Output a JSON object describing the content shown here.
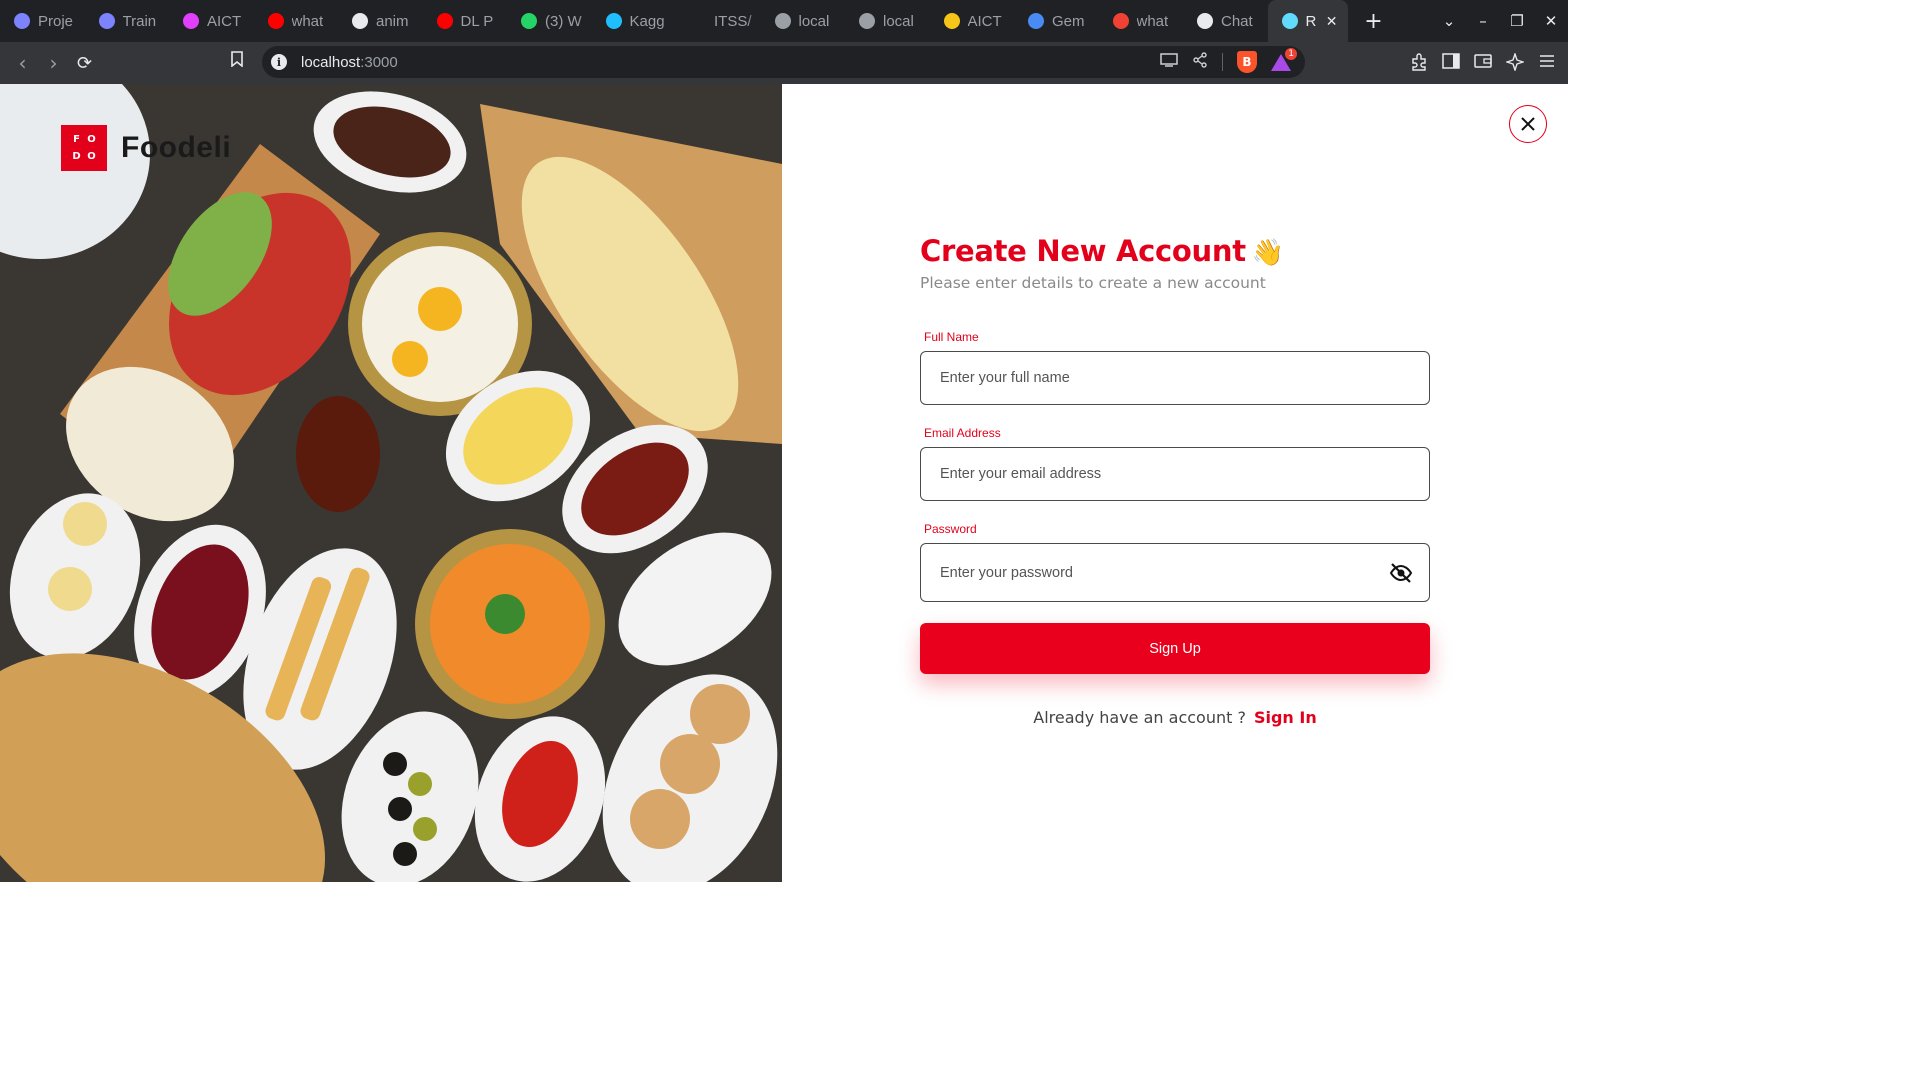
{
  "browser": {
    "tabs": [
      {
        "label": "Proje",
        "icon": "stack-icon",
        "color": "#7c83fd"
      },
      {
        "label": "Train",
        "icon": "stack-icon",
        "color": "#7c83fd"
      },
      {
        "label": "AICT",
        "icon": "play-arrow-icon",
        "color": "#e040fb"
      },
      {
        "label": "what",
        "icon": "youtube-icon",
        "color": "#ff0000"
      },
      {
        "label": "anim",
        "icon": "github-icon",
        "color": "#e8eaed"
      },
      {
        "label": "DL P",
        "icon": "youtube-icon",
        "color": "#ff0000"
      },
      {
        "label": "(3) W",
        "icon": "whatsapp-icon",
        "color": "#25d366"
      },
      {
        "label": "Kagg",
        "icon": "kaggle-icon",
        "color": "#20beff"
      },
      {
        "label": "ITSS/",
        "icon": "github-icon",
        "color": "#202124"
      },
      {
        "label": "local",
        "icon": "globe-icon",
        "color": "#9aa0a6"
      },
      {
        "label": "local",
        "icon": "react-icon",
        "color": "#9aa0a6"
      },
      {
        "label": "AICT",
        "icon": "lightbulb-icon",
        "color": "#f5c518"
      },
      {
        "label": "Gem",
        "icon": "gemini-icon",
        "color": "#4a8af4"
      },
      {
        "label": "what",
        "icon": "brave-shield-icon",
        "color": "#ef4234"
      },
      {
        "label": "Chat",
        "icon": "openai-icon",
        "color": "#e8eaed"
      },
      {
        "label": "R",
        "icon": "react-icon",
        "color": "#61dafb",
        "active": true
      }
    ],
    "new_tab": "+",
    "url_host": "localhost",
    "url_port": ":3000",
    "rewards_badge": "1",
    "brave_letter": "B",
    "window_controls": [
      "⌄",
      "–",
      "❐",
      "✕"
    ]
  },
  "brand": {
    "logo_letters": [
      "F",
      "O",
      "D",
      "O"
    ],
    "name": "Foodeli"
  },
  "form": {
    "title": "Create New Account",
    "wave_emoji": "👋",
    "subtitle": "Please enter details to create a new account",
    "full_name": {
      "label": "Full Name",
      "placeholder": "Enter your full name"
    },
    "email": {
      "label": "Email Address",
      "placeholder": "Enter your email address"
    },
    "password": {
      "label": "Password",
      "placeholder": "Enter your password"
    },
    "submit_label": "Sign Up",
    "prompt_text": "Already have an account ?",
    "signin_label": "Sign In"
  },
  "colors": {
    "accent": "#e3001b",
    "button": "#e8001c"
  }
}
